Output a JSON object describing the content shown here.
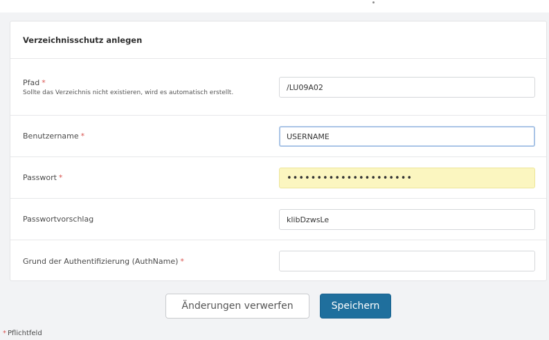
{
  "form": {
    "title": "Verzeichnisschutz anlegen",
    "required_mark": "*",
    "fields": {
      "path": {
        "label": "Pfad",
        "help": "Sollte das Verzeichnis nicht existieren, wird es automatisch erstellt.",
        "value": "/LU09A02"
      },
      "username": {
        "label": "Benutzername",
        "value": "USERNAME"
      },
      "password": {
        "label": "Passwort",
        "value": "•••••••••••••••••••••"
      },
      "password_suggestion": {
        "label": "Passwortvorschlag",
        "value": "klibDzwsLe"
      },
      "authname": {
        "label": "Grund der Authentifizierung (AuthName)",
        "value": ""
      }
    }
  },
  "actions": {
    "discard_label": "Änderungen verwerfen",
    "save_label": "Speichern"
  },
  "footnote": {
    "text": "Pflichtfeld"
  },
  "colors": {
    "primary": "#1f6f9d",
    "required": "#d9534f",
    "autofill": "#fbf6c0",
    "focus": "#a9c4e6"
  }
}
